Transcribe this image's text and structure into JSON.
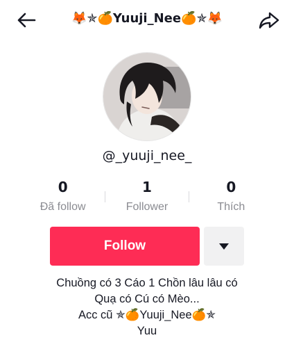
{
  "header": {
    "title": "🦊✯🍊Yuuji_Nee🍊✯🦊",
    "back_icon": "arrow-left-icon",
    "share_icon": "share-icon"
  },
  "profile": {
    "avatar_icon": "anime-avatar-image",
    "username": "@_yuuji_nee_"
  },
  "stats": [
    {
      "value": "0",
      "label": "Đã follow"
    },
    {
      "value": "1",
      "label": "Follower"
    },
    {
      "value": "0",
      "label": "Thích"
    }
  ],
  "actions": {
    "follow_label": "Follow",
    "more_icon": "caret-down-icon"
  },
  "bio": {
    "lines": [
      "Chuồng có 3 Cáo 1 Chồn lâu lâu có",
      "Quạ có Cú có Mèo...",
      "Acc cũ ✯🍊Yuuji_Nee🍊✯",
      "Yuu"
    ]
  },
  "colors": {
    "accent": "#fe2c55",
    "text": "#161823",
    "muted": "#8a8b91",
    "secondary_button": "#f1f1f2"
  }
}
